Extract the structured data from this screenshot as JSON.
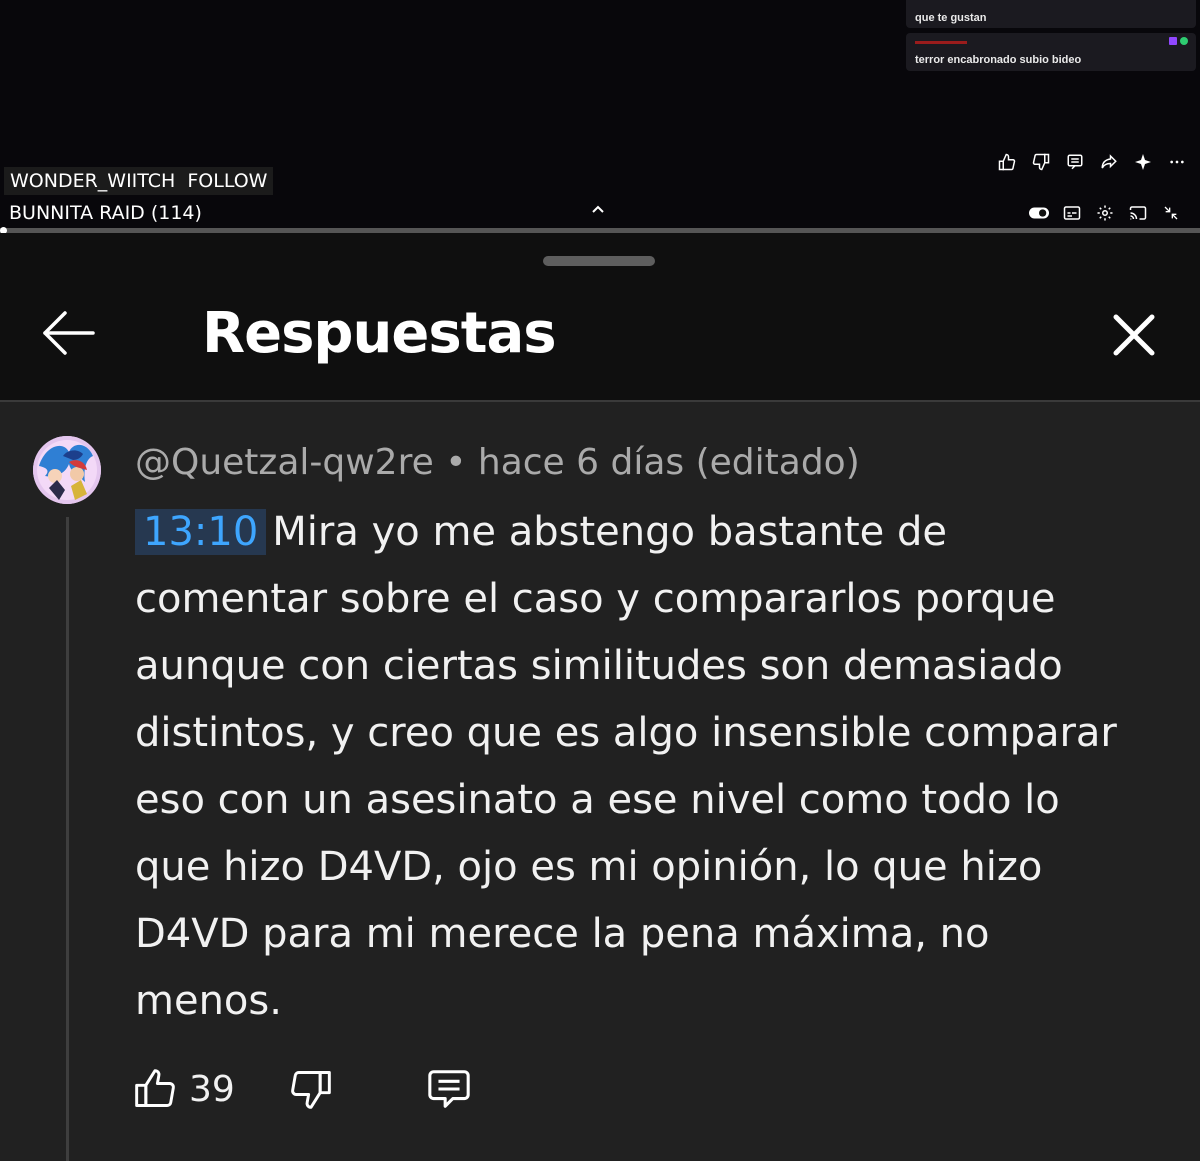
{
  "video": {
    "chat": [
      {
        "user": "",
        "text": "que te gustan"
      },
      {
        "user": "",
        "text": "terror encabronado subio bideo"
      }
    ],
    "streamer_name": "WONDER_WIITCH",
    "follow_label": "FOLLOW",
    "raid_label": "BUNNITA RAID (114)"
  },
  "sheet": {
    "title": "Respuestas"
  },
  "comment": {
    "author": "@Quetzal-qw2re",
    "separator": "•",
    "time": "hace 6 días (editado)",
    "timestamp_link": "13:10",
    "body": "Mira yo me abstengo bastante de comentar sobre el caso y compararlos porque aunque con ciertas similitudes son demasiado distintos, y creo que es algo insensible comparar eso con un asesinato a ese nivel como todo lo que hizo D4VD, ojo es mi opinión, lo que hizo D4VD para mi merece la pena máxima, no menos.",
    "like_count": "39"
  },
  "colors": {
    "timestamp_fg": "#3ea6ff",
    "timestamp_bg": "#263850",
    "sheet_bg": "#0f0f0f",
    "comment_bg": "#212121"
  },
  "icons": [
    "back-arrow-icon",
    "close-icon",
    "thumbs-up-icon",
    "thumbs-down-icon",
    "reply-icon",
    "share-icon",
    "sparkle-icon",
    "more-icon",
    "toggle-icon",
    "captions-icon",
    "settings-icon",
    "cast-icon",
    "collapse-icon"
  ]
}
